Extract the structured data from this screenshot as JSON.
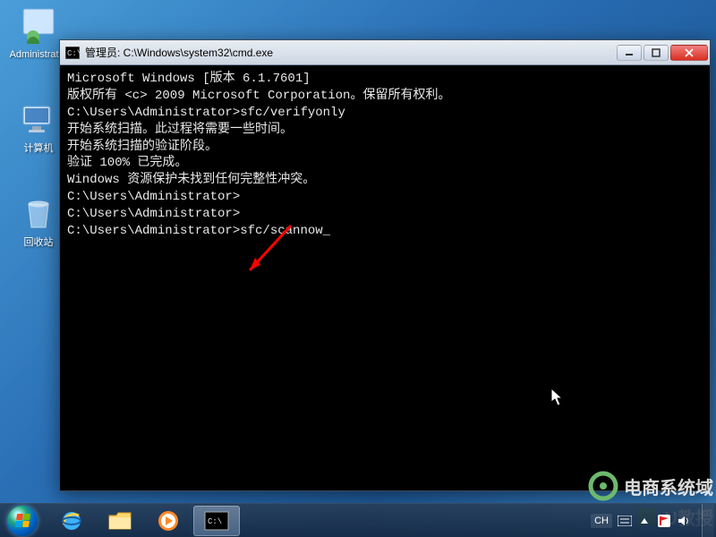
{
  "desktop": {
    "icons": {
      "admin": {
        "label": "Administrator"
      },
      "computer": {
        "label": "计算机"
      },
      "recycle": {
        "label": "回收站"
      }
    }
  },
  "cmd": {
    "title": "管理员: C:\\Windows\\system32\\cmd.exe",
    "lines": [
      "Microsoft Windows [版本 6.1.7601]",
      "版权所有 <c> 2009 Microsoft Corporation。保留所有权利。",
      "",
      "C:\\Users\\Administrator>sfc/verifyonly",
      "",
      "开始系统扫描。此过程将需要一些时间。",
      "",
      "开始系统扫描的验证阶段。",
      "验证 100% 已完成。",
      "",
      "Windows 资源保护未找到任何完整性冲突。",
      "",
      "C:\\Users\\Administrator>",
      "C:\\Users\\Administrator>",
      "C:\\Users\\Administrator>sfc/scannow"
    ]
  },
  "taskbar": {
    "lang": "CH",
    "clock": {
      "time": "",
      "date": ""
    }
  },
  "watermark": {
    "brand1": "电商系统域",
    "brand2": "U教授"
  },
  "colors": {
    "flag": {
      "tl": "#f25022",
      "tr": "#7fba00",
      "bl": "#00a4ef",
      "br": "#ffb900"
    }
  }
}
